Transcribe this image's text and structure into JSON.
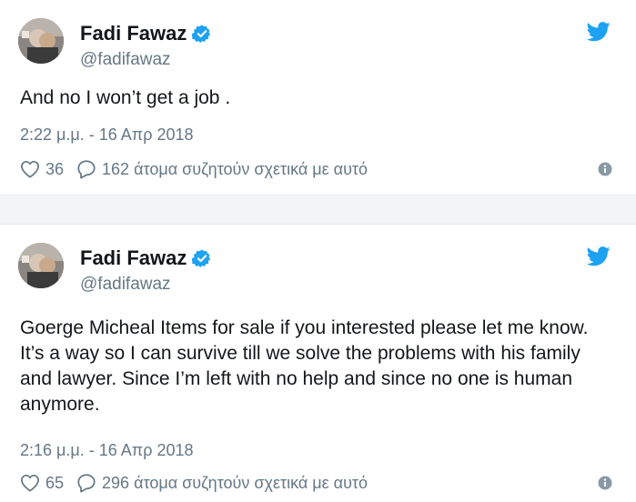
{
  "colors": {
    "twitter_blue": "#1da1f2",
    "secondary_text": "#657786",
    "primary_text": "#14171a",
    "background": "#f3f4f6",
    "card": "#ffffff"
  },
  "icons": {
    "verified": "verified-badge-icon",
    "bird": "twitter-bird-icon",
    "like": "heart-outline-icon",
    "reply": "speech-bubble-icon",
    "info": "info-circle-icon"
  },
  "tweets": [
    {
      "author": {
        "name": "Fadi Fawaz",
        "handle": "@fadifawaz"
      },
      "text": "And no I won’t get a job .",
      "timestamp": "2:22 μ.μ. - 16 Απρ 2018",
      "likes": "36",
      "replies_text": "162 άτομα συζητούν σχετικά με αυτό"
    },
    {
      "author": {
        "name": "Fadi Fawaz",
        "handle": "@fadifawaz"
      },
      "text": "Goerge Micheal Items for sale if you interested please let me know. It’s a way so I can survive till we solve the problems with his family and lawyer. Since I’m left with no help and since no one is human anymore.",
      "timestamp": "2:16 μ.μ. - 16 Απρ 2018",
      "likes": "65",
      "replies_text": "296 άτομα συζητούν σχετικά με αυτό"
    }
  ]
}
